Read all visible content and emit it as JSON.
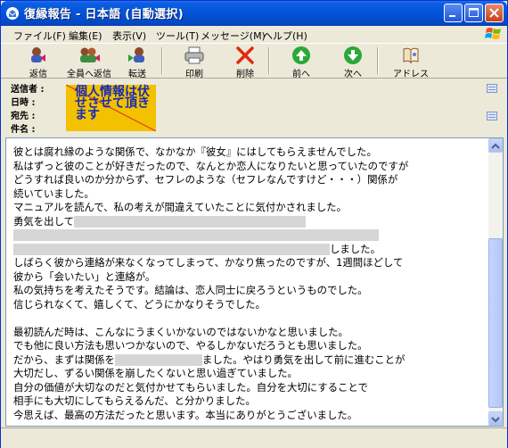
{
  "window": {
    "title": "復縁報告 - 日本語 (自動選択)"
  },
  "menu": [
    "ファイル(F)",
    "編集(E)",
    "表示(V)",
    "ツール(T)",
    "メッセージ(M)",
    "ヘルプ(H)"
  ],
  "toolbar": {
    "reply": "返信",
    "reply_all": "全員へ返信",
    "forward": "転送",
    "print": "印刷",
    "delete": "削除",
    "prev": "前へ",
    "next": "次へ",
    "address": "アドレス"
  },
  "headers": {
    "from": "送信者 :",
    "date": "日時 :",
    "to": "宛先 :",
    "subject": "件名 :",
    "privacy_notice": "個人情報は伏せさせて頂きます"
  },
  "message": {
    "lines": [
      "彼とは腐れ縁のような関係で、なかなか『彼女』にはしてもらえませんでした。",
      "私はずっと彼のことが好きだったので、なんとか恋人になりたいと思っていたのですが",
      "どうすれば良いのか分からず、セフレのような（セフレなんですけど・・・）関係が",
      "続いていました。",
      "マニュアルを読んで、私の考えが間違えていたことに気付かされました。",
      "勇気を出して",
      "",
      "しました。",
      "しばらく彼から連絡が来なくなってしまって、かなり焦ったのですが、1週間ほどして",
      "彼から「会いたい」と連絡が。",
      "私の気持ちを考えたそうです。結論は、恋人同士に戻ろうというものでした。",
      "信じられなくて、嬉しくて、どうにかなりそうでした。",
      "",
      "最初読んだ時は、こんなにうまくいかないのではないかなと思いました。",
      "でも他に良い方法も思いつかないので、やるしかないだろうとも思いました。",
      "だから、まずは関係を",
      "ました。やはり勇気を出して前に進むことが",
      "大切だし、ずるい関係を崩したくないと思い過ぎていました。",
      "自分の価値が大切なのだと気付かせてもらいました。自分を大切にすることで",
      "相手にも大切にしてもらえるんだ、と分かりました。",
      "今思えば、最高の方法だったと思います。本当にありがとうございました。"
    ]
  },
  "colors": {
    "titlebar": "#0454d8",
    "privacy_bg": "#f2c200",
    "privacy_text": "#1a2ab5"
  }
}
